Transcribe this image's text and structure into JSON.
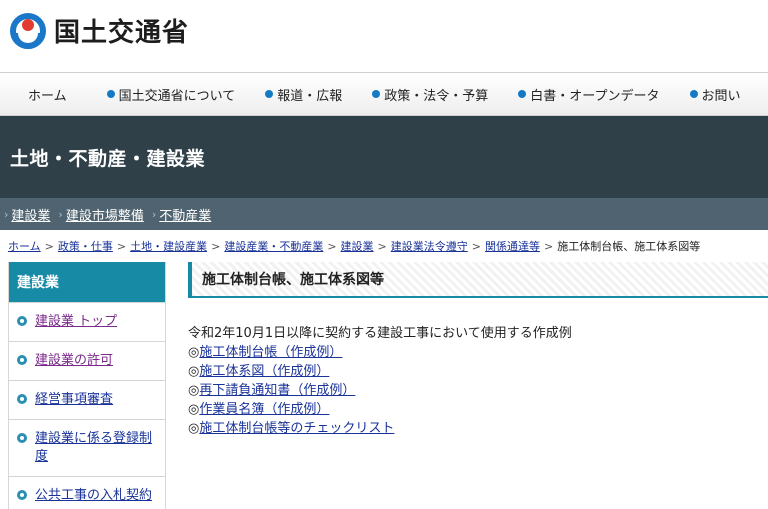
{
  "header": {
    "site_title": "国土交通省",
    "brand_colors": {
      "blue": "#1b78c9",
      "red": "#e23b2f"
    }
  },
  "gnav": {
    "items": [
      {
        "label": "ホーム",
        "dot": false
      },
      {
        "label": "国土交通省について",
        "dot": true
      },
      {
        "label": "報道・広報",
        "dot": true
      },
      {
        "label": "政策・法令・予算",
        "dot": true
      },
      {
        "label": "白書・オープンデータ",
        "dot": true
      },
      {
        "label": "お問い",
        "dot": true
      }
    ]
  },
  "banner": {
    "title": "土地・不動産・建設業"
  },
  "subnav": {
    "links": [
      "建設業",
      "建設市場整備",
      "不動産業"
    ]
  },
  "breadcrumb": {
    "links": [
      "ホーム",
      "政策・仕事",
      "土地・建設産業",
      "建設産業・不動産業",
      "建設業",
      "建設業法令遵守",
      "関係通達等"
    ],
    "current": "施工体制台帳、施工体系図等",
    "separator": ">"
  },
  "sidebar": {
    "heading": "建設業",
    "items": [
      {
        "label": "建設業 トップ",
        "visited": true
      },
      {
        "label": "建設業の許可",
        "visited": true
      },
      {
        "label": "経営事項審査",
        "visited": false
      },
      {
        "label": "建設業に係る登録制度",
        "visited": false
      },
      {
        "label": "公共工事の入札契約",
        "visited": false
      }
    ]
  },
  "main": {
    "heading": "施工体制台帳、施工体系図等",
    "intro": "令和2年10月1日以降に契約する建設工事において使用する作成例",
    "mark": "◎",
    "documents": [
      "施工体制台帳（作成例）",
      "施工体系図（作成例）",
      "再下請負通知書（作成例）",
      "作業員名簿（作成例）",
      "施工体制台帳等のチェックリスト"
    ]
  },
  "colors": {
    "banner_bg": "#2f4048",
    "subnav_bg": "#4f6470",
    "accent_teal": "#178aa6",
    "link": "#1a3399",
    "visited_link": "#7a2a8a"
  }
}
